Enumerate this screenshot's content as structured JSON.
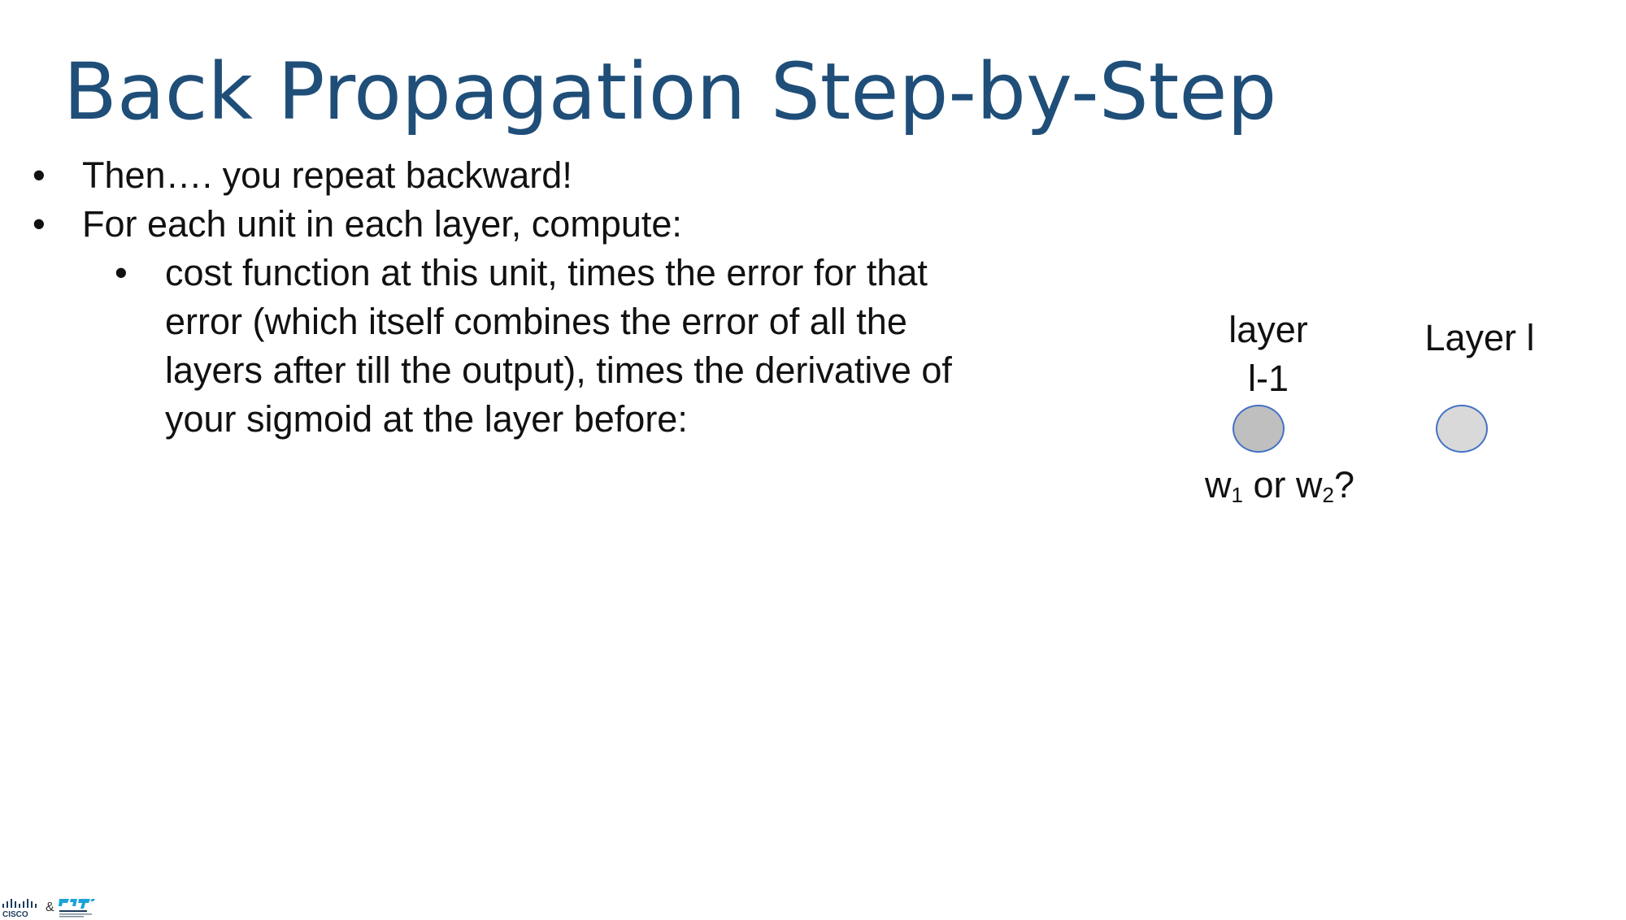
{
  "title": "Back Propagation Step-by-Step",
  "bullets": [
    {
      "level": 1,
      "text": "Then…. you repeat backward!"
    },
    {
      "level": 1,
      "text": "For each unit in each layer, compute:"
    },
    {
      "level": 2,
      "text": "cost function at this unit, times the error for that error (which itself combines the error of all the layers after till the output), times the derivative of your sigmoid at the layer before:"
    }
  ],
  "bullet_glyph": "•",
  "diagram": {
    "layer_prev_label_line1": "layer",
    "layer_prev_label_line2": "l-1",
    "layer_curr_label": "Layer l",
    "question": {
      "w": "w",
      "sub1": "1",
      "or": " or ",
      "sub2": "2",
      "q": "?"
    }
  },
  "logo": {
    "left_brand": "CISCO",
    "ampersand": "&"
  },
  "colors": {
    "title": "#1f4e79",
    "node_border": "#4472c4",
    "node_prev_fill": "#bfbfbf",
    "node_curr_fill": "#d9d9d9"
  }
}
